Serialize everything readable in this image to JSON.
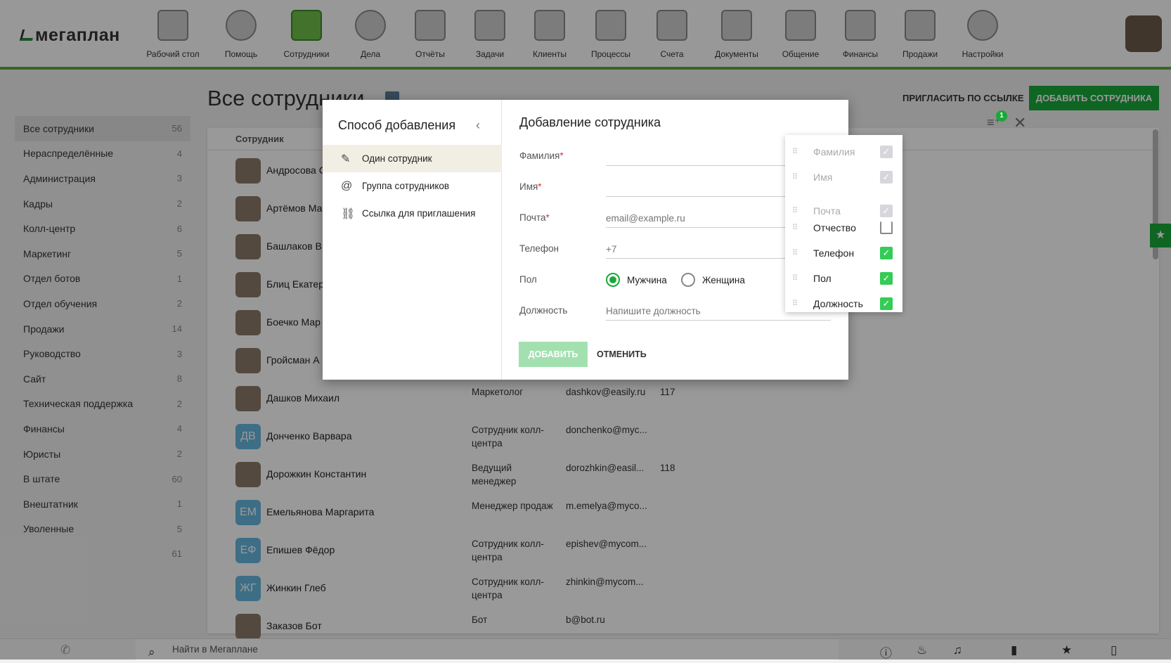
{
  "header": {
    "logo": "мегаплан",
    "nav": [
      {
        "label": "Рабочий стол",
        "icon": "desktop-icon"
      },
      {
        "label": "Помощь",
        "icon": "lifebuoy-icon"
      },
      {
        "label": "Сотрудники",
        "icon": "employees-icon",
        "active": true
      },
      {
        "label": "Дела",
        "icon": "clock-icon"
      },
      {
        "label": "Отчёты",
        "icon": "reports-icon"
      },
      {
        "label": "Задачи",
        "icon": "tasks-icon"
      },
      {
        "label": "Клиенты",
        "icon": "clients-icon"
      },
      {
        "label": "Процессы",
        "icon": "processes-icon"
      },
      {
        "label": "Счета",
        "icon": "invoices-icon"
      },
      {
        "label": "Документы",
        "icon": "documents-icon"
      },
      {
        "label": "Общение",
        "icon": "chat-icon"
      },
      {
        "label": "Финансы",
        "icon": "safe-icon"
      },
      {
        "label": "Продажи",
        "icon": "briefcase-icon"
      },
      {
        "label": "Настройки",
        "icon": "gear-icon"
      }
    ]
  },
  "page": {
    "title": "Все сотрудники",
    "invite": "ПРИГЛАСИТЬ ПО ССЫЛКЕ",
    "add": "ДОБАВИТЬ СОТРУДНИКА"
  },
  "sidebar": [
    {
      "label": "Все сотрудники",
      "count": "56",
      "active": true
    },
    {
      "label": "Нераспределённые",
      "count": "4"
    },
    {
      "label": "Администрация",
      "count": "3"
    },
    {
      "label": "Кадры",
      "count": "2"
    },
    {
      "label": "Колл-центр",
      "count": "6"
    },
    {
      "label": "Маркетинг",
      "count": "5"
    },
    {
      "label": "Отдел ботов",
      "count": "1"
    },
    {
      "label": "Отдел обучения",
      "count": "2"
    },
    {
      "label": "Продажи",
      "count": "14"
    },
    {
      "label": "Руководство",
      "count": "3"
    },
    {
      "label": "Сайт",
      "count": "8"
    },
    {
      "label": "Техническая поддержка",
      "count": "2"
    },
    {
      "label": "Финансы",
      "count": "4"
    },
    {
      "label": "Юристы",
      "count": "2"
    },
    {
      "label": "В штате",
      "count": "60"
    },
    {
      "label": "Внештатник",
      "count": "1"
    },
    {
      "label": "Уволенные",
      "count": "5"
    },
    {
      "label": "",
      "count": "61"
    }
  ],
  "table": {
    "header": "Сотрудник",
    "rows": [
      {
        "name": "Андросова С",
        "initials": "",
        "position": "",
        "email": "",
        "ext": ""
      },
      {
        "name": "Артёмов Ма",
        "initials": "",
        "position": "",
        "email": "",
        "ext": ""
      },
      {
        "name": "Башлаков В",
        "initials": "",
        "position": "",
        "email": "",
        "ext": ""
      },
      {
        "name": "Блиц Екатер",
        "initials": "",
        "position": "",
        "email": "",
        "ext": ""
      },
      {
        "name": "Боечко Мар",
        "initials": "",
        "position": "",
        "email": "",
        "ext": ""
      },
      {
        "name": "Гройсман А",
        "initials": "",
        "position": "",
        "email": "",
        "ext": ""
      },
      {
        "name": "Дашков Михаил",
        "initials": "",
        "position": "Маркетолог",
        "email": "dashkov@easily.ru",
        "ext": "117"
      },
      {
        "name": "Донченко Варвара",
        "initials": "ДВ",
        "position": "Сотрудник колл-центра",
        "email": "donchenko@myc...",
        "ext": ""
      },
      {
        "name": "Дорожкин Константин",
        "initials": "",
        "position": "Ведущий менеджер",
        "email": "dorozhkin@easil...",
        "ext": "118"
      },
      {
        "name": "Емельянова Маргарита",
        "initials": "ЕМ",
        "position": "Менеджер продаж",
        "email": "m.emelya@myco...",
        "ext": ""
      },
      {
        "name": "Епишев Фёдор",
        "initials": "ЕФ",
        "position": "Сотрудник колл-центра",
        "email": "epishev@mycom...",
        "ext": ""
      },
      {
        "name": "Жинкин Глеб",
        "initials": "ЖГ",
        "position": "Сотрудник колл-центра",
        "email": "zhinkin@mycom...",
        "ext": ""
      },
      {
        "name": "Заказов Бот",
        "initials": "",
        "position": "Бот",
        "email": "b@bot.ru",
        "ext": ""
      }
    ]
  },
  "footer": {
    "search_placeholder": "Найти в Мегаплане"
  },
  "modal": {
    "left_title": "Способ добавления",
    "methods": [
      {
        "label": "Один сотрудник",
        "icon": "pencil-icon",
        "active": true
      },
      {
        "label": "Группа сотрудников",
        "icon": "at-icon"
      },
      {
        "label": "Ссылка для приглашения",
        "icon": "link-icon"
      }
    ],
    "title": "Добавление сотрудника",
    "badge": "1",
    "fields": {
      "lastname": "Фамилия",
      "firstname": "Имя",
      "email": "Почта",
      "email_placeholder": "email@example.ru",
      "phone": "Телефон",
      "phone_placeholder": "+7",
      "gender": "Пол",
      "male": "Мужчина",
      "female": "Женщина",
      "position": "Должность",
      "position_placeholder": "Напишите должность",
      "required": "*"
    },
    "gender_selected": "Мужчина",
    "submit": "ДОБАВИТЬ",
    "cancel": "ОТМЕНИТЬ"
  },
  "columns_menu": [
    {
      "label": "Фамилия",
      "state": "disabled"
    },
    {
      "label": "Имя",
      "state": "disabled"
    },
    {
      "label": "Почта",
      "state": "disabled"
    },
    {
      "label": "Отчество",
      "state": "unchecked"
    },
    {
      "label": "Телефон",
      "state": "checked"
    },
    {
      "label": "Пол",
      "state": "checked"
    },
    {
      "label": "Должность",
      "state": "checked"
    }
  ],
  "colors": {
    "accent": "#1aa83a",
    "nav_line": "#5fa83a",
    "check": "#33cc55",
    "avatar": "#66b8e0"
  }
}
